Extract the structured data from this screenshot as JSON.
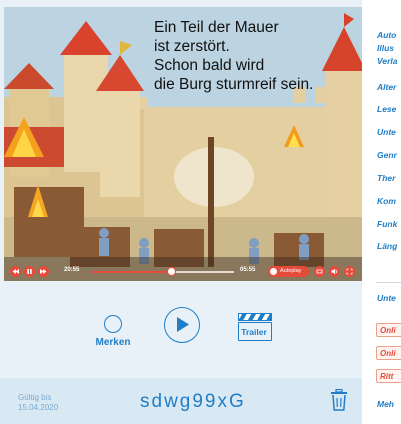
{
  "video": {
    "caption_lines": [
      "Ein Teil der Mauer",
      "ist zerstört.",
      "Schon bald wird",
      "die Burg sturmreif sein."
    ],
    "player": {
      "time_elapsed": "20:55",
      "time_total": "05:55",
      "progress": 0.56,
      "autoplay_label": "Autoplay"
    }
  },
  "actions": {
    "merken_label": "Merken",
    "trailer_label": "Trailer"
  },
  "footer": {
    "valid_label": "Gültig bis",
    "valid_date": "15.04.2020",
    "code": "sdwg99xG"
  },
  "sidebar": {
    "items": [
      "Auto",
      "Illus",
      "Verla",
      "Alter",
      "Lese",
      "Unte",
      "Genr",
      "Ther",
      "Kom",
      "Funk",
      "Läng",
      "Unte"
    ],
    "tags": [
      "Onli",
      "Onli",
      "Ritt"
    ],
    "more_label": "Meh"
  },
  "colors": {
    "accent": "#1f7ec7",
    "player_red": "#e64a3b",
    "background": "#e8f1f7"
  }
}
